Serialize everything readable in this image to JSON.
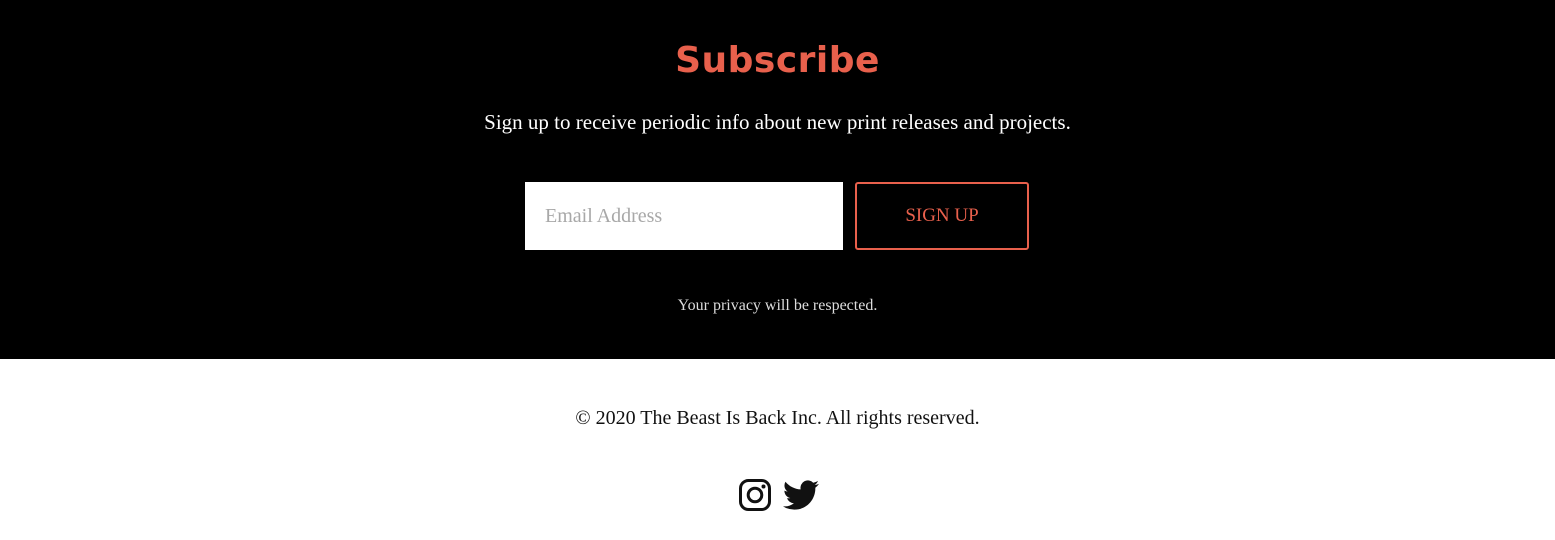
{
  "colors": {
    "accent": "#e8604c",
    "background_dark": "#000000",
    "background_light": "#ffffff",
    "text_light": "#ffffff",
    "text_dark": "#111111"
  },
  "subscribe": {
    "title": "Subscribe",
    "description": "Sign up to receive periodic info about new print releases and projects.",
    "email_placeholder": "Email Address",
    "email_value": "",
    "button_label": "SIGN UP",
    "privacy_note": "Your privacy will be respected."
  },
  "footer": {
    "copyright": "© 2020 The Beast Is Back Inc. All rights reserved.",
    "social": [
      {
        "icon": "instagram-icon"
      },
      {
        "icon": "twitter-icon"
      }
    ]
  }
}
